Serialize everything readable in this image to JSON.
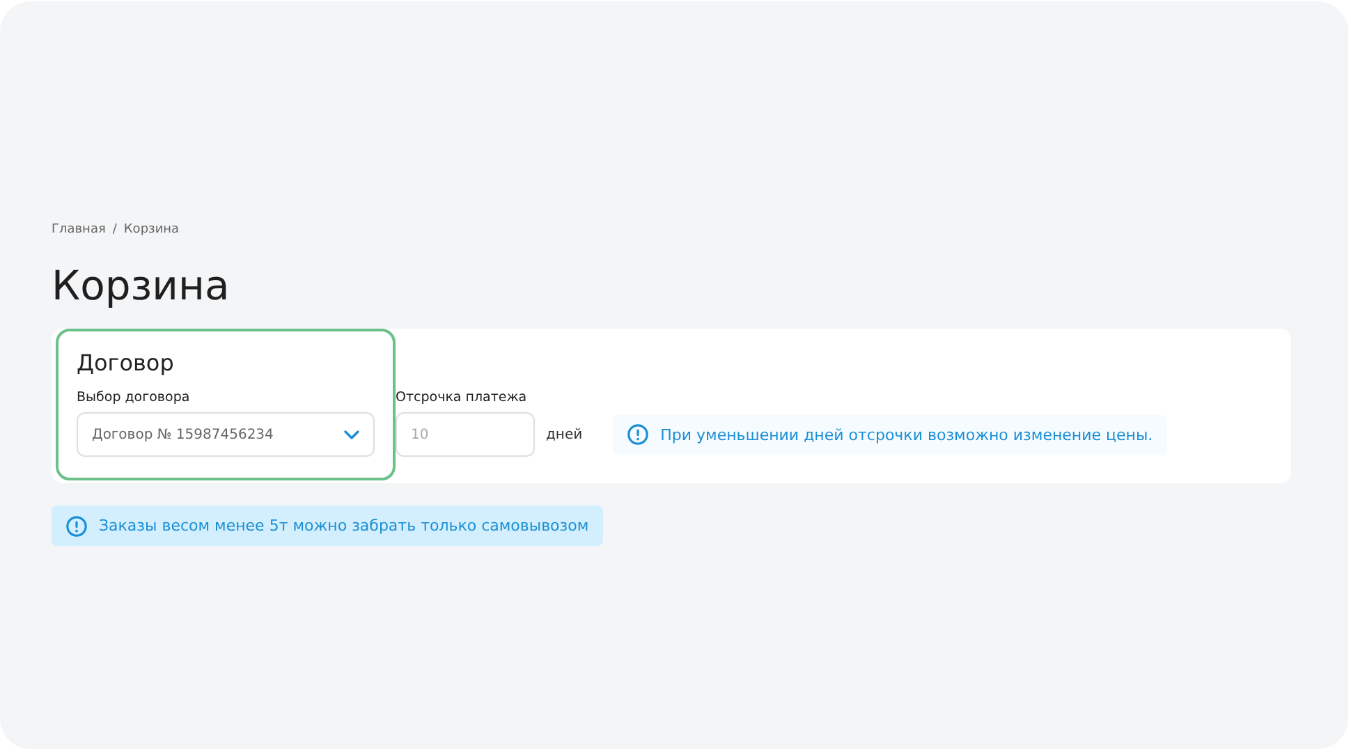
{
  "breadcrumbs": [
    {
      "label": "Главная"
    },
    {
      "label": "Корзина"
    }
  ],
  "breadcrumb_separator": "/",
  "title": "Корзина",
  "contract": {
    "heading": "Договор",
    "highlighted": true,
    "label": "Выбор договора",
    "value": "Договор № 15987456234"
  },
  "payment_delay": {
    "label": "Отсрочка платежа",
    "placeholder": "10",
    "unit": "дней"
  },
  "notices": [
    {
      "text": "При уменьшении дней отсрочки возможно изменение цены.",
      "kind": "light"
    },
    {
      "text": "Заказы весом менее 5т можно забрать только самовывозом",
      "kind": "filled"
    }
  ]
}
